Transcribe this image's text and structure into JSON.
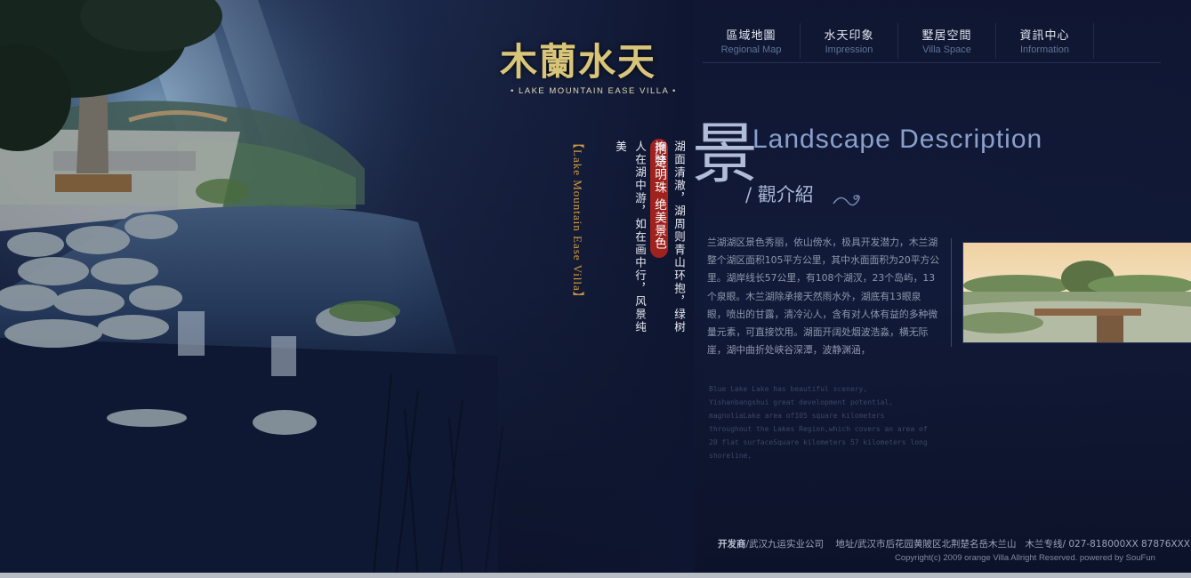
{
  "nav": [
    {
      "cn": "區域地圖",
      "en": "Regional Map"
    },
    {
      "cn": "水天印象",
      "en": "Impression"
    },
    {
      "cn": "墅居空間",
      "en": "Villa Space"
    },
    {
      "cn": "資訊中心",
      "en": "Information"
    }
  ],
  "logo": {
    "title": "木蘭水天",
    "subtitle": "• LAKE MOUNTAIN EASE VILLA •"
  },
  "slogan": {
    "badge": "荆楚明珠 绝美景色",
    "poem_line1": "湖面清澈，湖周则青山环抱，绿树掩映，",
    "poem_line2": "人在湖中游，如在画中行，风景纯美",
    "en_vertical": "【Lake Mountain Ease Villa】"
  },
  "section": {
    "big_char": "景",
    "title_en": "Landscape Description",
    "title_cn": "/ 觀介紹",
    "description": "兰湖湖区景色秀丽，依山傍水，极具开发潜力，木兰湖整个湖区面积105平方公里，其中水面面积为20平方公里。湖岸线长57公里，有108个湖汊，23个岛屿，13个泉眼。木兰湖除承接天然雨水外，湖底有13眼泉眼，喷出的甘露，清冷沁人，含有对人体有益的多种微量元素，可直接饮用。湖面开阔处烟波浩淼，横无际崖，湖中曲折处峡谷深潭，波静渊涵，",
    "description_en": "Blue Lake Lake has beautiful scenery, Yishanbangshui great development potential, magnoliaLake area of105 square kilometers throughout the Lakes Region,which covers an area of 20 flat surfaceSquare kilometers 57 kilometers long shoreline,"
  },
  "footer": {
    "developer_label": "开发商",
    "developer": "/武汉九运实业公司",
    "address": "地址/武汉市后花园黄陂区北荆楚名岳木兰山",
    "hotline": "木兰专线/ 027-818000XX 87876XXX",
    "copyright": "Copyright(c) 2009  orange Villa Allright Reserved.  powered by SouFun"
  }
}
